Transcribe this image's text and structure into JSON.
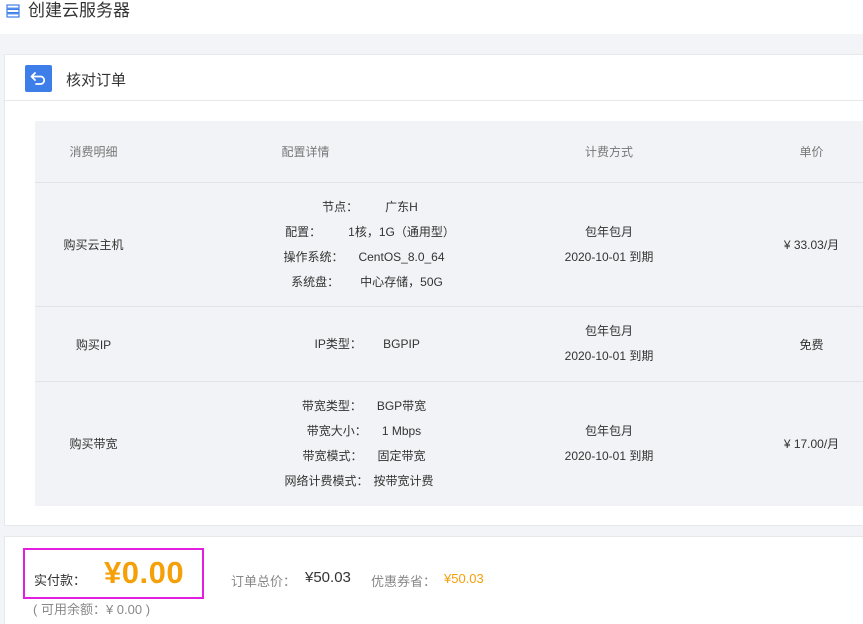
{
  "page": {
    "title": "创建云服务器"
  },
  "card": {
    "title": "核对订单"
  },
  "table": {
    "headers": [
      "消费明细",
      "配置详情",
      "计费方式",
      "单价"
    ],
    "rows": [
      {
        "item": "购买云主机",
        "details": [
          {
            "k": "节点：",
            "v": "广东H"
          },
          {
            "k": "配置：",
            "v": "1核，1G（通用型）"
          },
          {
            "k": "操作系统：",
            "v": "CentOS_8.0_64"
          },
          {
            "k": "系统盘：",
            "v": "中心存储，50G"
          }
        ],
        "billing": "包年包月",
        "expire": "2020-10-01 到期",
        "price": "¥ 33.03/月"
      },
      {
        "item": "购买IP",
        "details": [
          {
            "k": "IP类型：",
            "v": "BGPIP"
          }
        ],
        "billing": "包年包月",
        "expire": "2020-10-01 到期",
        "price": "免费"
      },
      {
        "item": "购买带宽",
        "details": [
          {
            "k": "带宽类型：",
            "v": "BGP带宽"
          },
          {
            "k": "带宽大小：",
            "v": "1 Mbps"
          },
          {
            "k": "带宽模式：",
            "v": "固定带宽"
          },
          {
            "k": "网络计费模式：",
            "v": "按带宽计费"
          }
        ],
        "billing": "包年包月",
        "expire": "2020-10-01 到期",
        "price": "¥ 17.00/月"
      }
    ]
  },
  "payment": {
    "label": "实付款：",
    "amount": "¥0.00",
    "total_label": "订单总价：",
    "total_value": "¥50.03",
    "coupon_label": "优惠券省：",
    "coupon_value": "¥50.03",
    "balance": "( 可用余额：¥ 0.00 )"
  },
  "colors": {
    "accent": "#3d7ee8",
    "price": "#f5a009",
    "highlight": "#e21fe0"
  },
  "icons": {
    "header": "server-list-icon",
    "back": "back-arrow-icon"
  }
}
